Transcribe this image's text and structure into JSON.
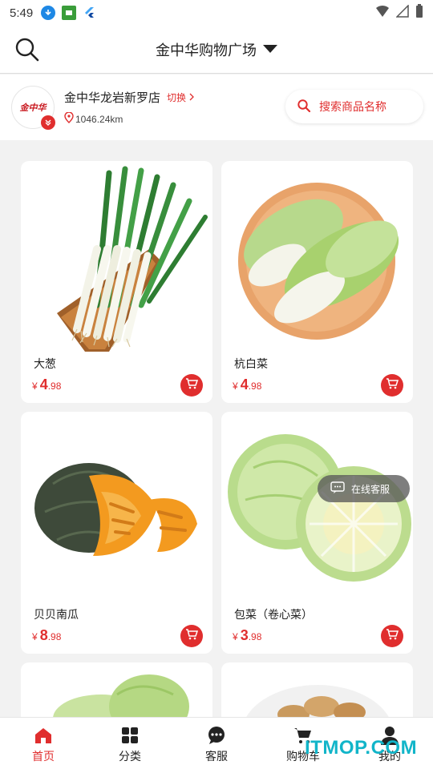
{
  "status_bar": {
    "time": "5:49"
  },
  "header": {
    "title": "金中华购物广场"
  },
  "store": {
    "logo_text": "金中华",
    "name": "金中华龙岩新罗店",
    "switch_label": "切换",
    "distance": "1046.24km",
    "search_placeholder": "搜索商品名称"
  },
  "products": [
    {
      "name": "大葱",
      "currency": "¥",
      "price_int": "4",
      "price_dec": ".98"
    },
    {
      "name": "杭白菜",
      "currency": "¥",
      "price_int": "4",
      "price_dec": ".98"
    },
    {
      "name": "贝贝南瓜",
      "currency": "¥",
      "price_int": "8",
      "price_dec": ".98"
    },
    {
      "name": "包菜（卷心菜）",
      "currency": "¥",
      "price_int": "3",
      "price_dec": ".98"
    }
  ],
  "chat_float": {
    "label": "在线客服"
  },
  "tabs": [
    {
      "label": "首页",
      "icon": "home-icon",
      "active": true
    },
    {
      "label": "分类",
      "icon": "grid-icon",
      "active": false
    },
    {
      "label": "客服",
      "icon": "chat-icon",
      "active": false
    },
    {
      "label": "购物车",
      "icon": "cart-icon",
      "active": false
    },
    {
      "label": "我的",
      "icon": "user-icon",
      "active": false
    }
  ],
  "watermark": "ITMOP.COM",
  "colors": {
    "accent": "#e02e2e",
    "watermark": "#12b5c9"
  }
}
